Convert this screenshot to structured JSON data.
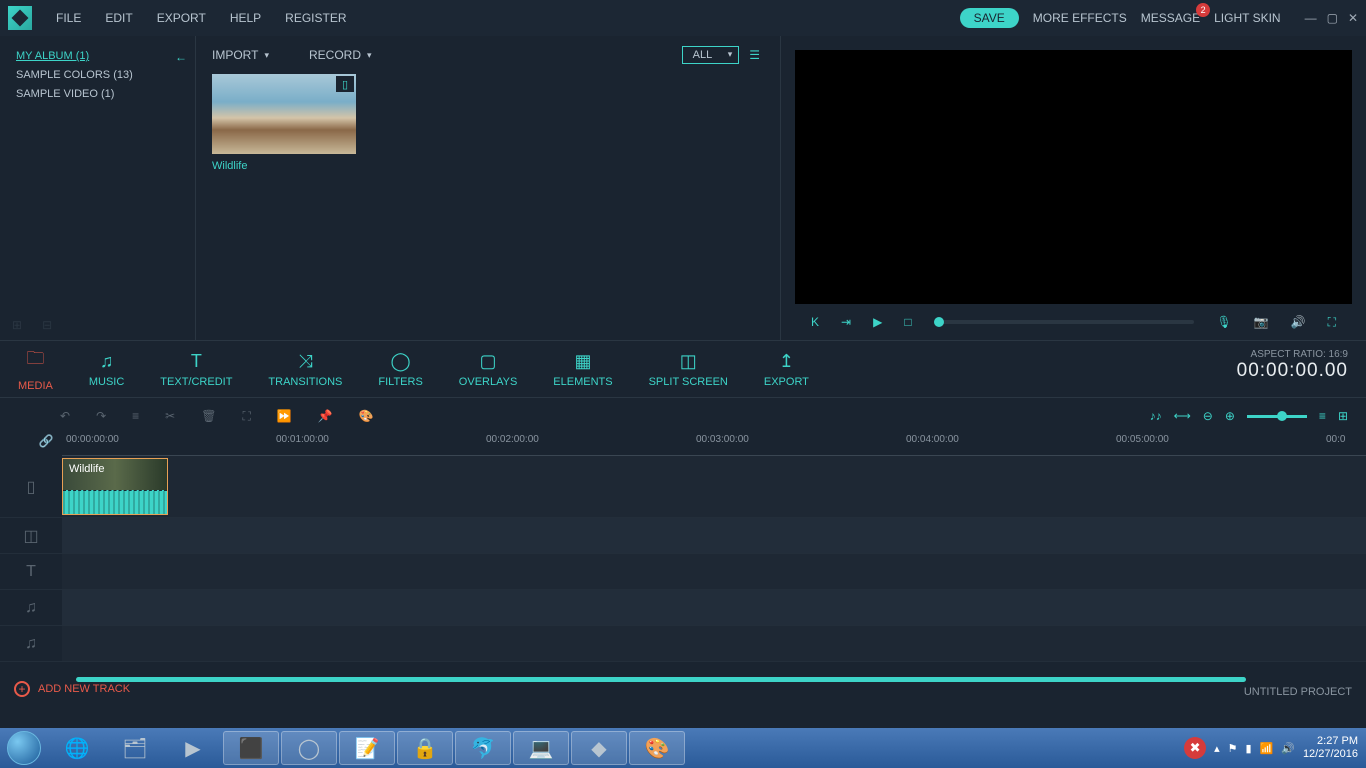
{
  "menu": {
    "file": "FILE",
    "edit": "EDIT",
    "export": "EXPORT",
    "help": "HELP",
    "register": "REGISTER"
  },
  "titlebar": {
    "save": "SAVE",
    "more_effects": "MORE EFFECTS",
    "message": "MESSAGE",
    "badge": "2",
    "light_skin": "LIGHT SKIN"
  },
  "sidebar": {
    "items": [
      "MY ALBUM (1)",
      "SAMPLE COLORS (13)",
      "SAMPLE VIDEO (1)"
    ]
  },
  "media": {
    "import": "IMPORT",
    "record": "RECORD",
    "filter": "ALL",
    "thumb_label": "Wildlife"
  },
  "preview": {
    "aspect": "ASPECT RATIO:  16:9",
    "timecode": "00:00:00.00"
  },
  "tabs": {
    "media": "MEDIA",
    "music": "MUSIC",
    "text": "TEXT/CREDIT",
    "transitions": "TRANSITIONS",
    "filters": "FILTERS",
    "overlays": "OVERLAYS",
    "elements": "ELEMENTS",
    "split": "SPLIT SCREEN",
    "export": "EXPORT"
  },
  "ruler": [
    "00:00:00:00",
    "00:01:00:00",
    "00:02:00:00",
    "00:03:00:00",
    "00:04:00:00",
    "00:05:00:00",
    "00:0"
  ],
  "clip": {
    "name": "Wildlife"
  },
  "footer": {
    "add_track": "ADD NEW TRACK",
    "project": "UNTITLED PROJECT"
  },
  "taskbar": {
    "time": "2:27 PM",
    "date": "12/27/2016"
  }
}
